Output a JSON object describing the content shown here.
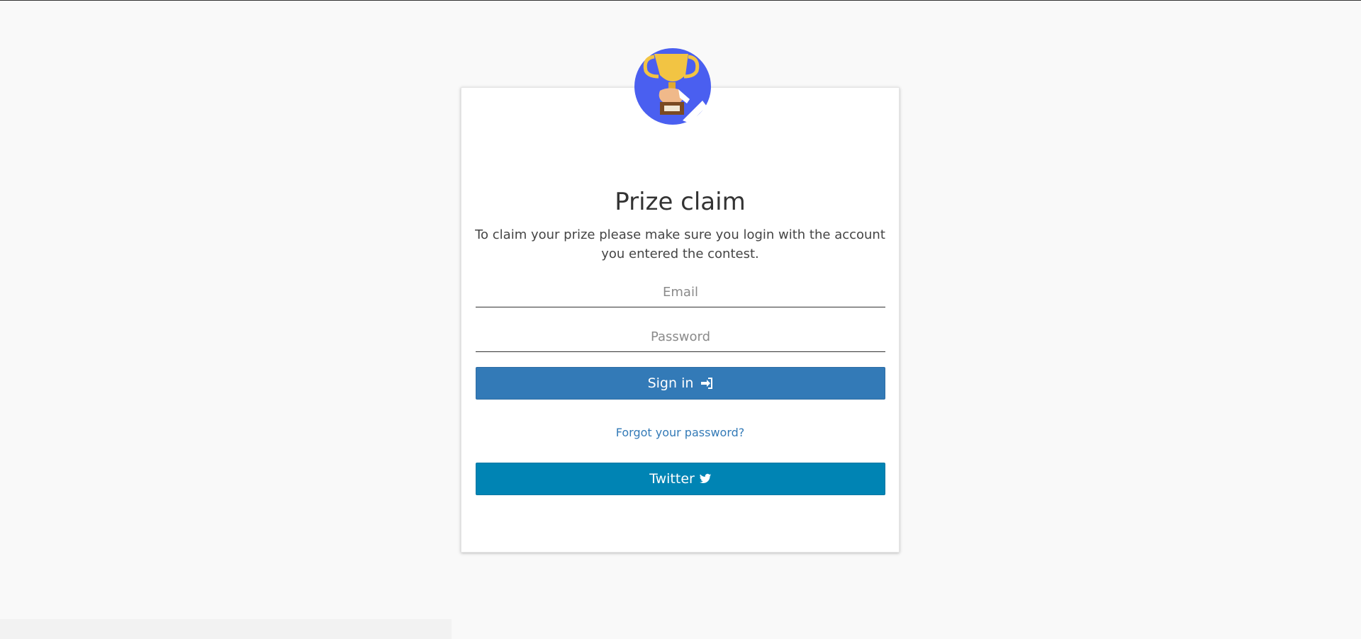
{
  "page": {
    "title": "Prize claim",
    "subtitle": "To claim your prize please make sure you login with the account you entered the contest."
  },
  "form": {
    "email_placeholder": "Email",
    "email_value": "",
    "password_placeholder": "Password",
    "password_value": "",
    "signin_label": "Sign in",
    "signin_icon": "sign-in-icon",
    "forgot_label": "Forgot your password?",
    "twitter_label": "Twitter",
    "twitter_icon": "twitter-bird-icon"
  },
  "logo": {
    "icon": "trophy-hand-icon"
  },
  "colors": {
    "background": "#f9f9f9",
    "card": "#ffffff",
    "signin_button": "#337ab7",
    "twitter_button": "#0084b4",
    "link": "#337ab7",
    "logo_circle": "#4a5ff0",
    "trophy": "#f2c443"
  }
}
